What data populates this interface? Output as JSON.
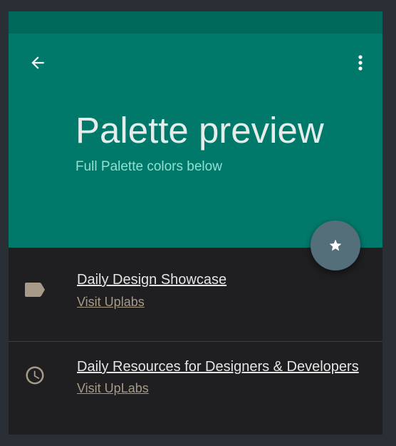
{
  "colors": {
    "primary": "#00796b",
    "primary_dark": "#00695c",
    "accent": "#546e7a",
    "background": "#1f1f21",
    "subtitle": "#8fe0d3",
    "link": "#a99a86"
  },
  "app_bar": {
    "back_icon": "arrow-back-icon",
    "more_icon": "more-vert-icon",
    "title": "Palette preview",
    "subtitle": "Full Palette colors below"
  },
  "fab": {
    "icon": "star-icon"
  },
  "list": {
    "items": [
      {
        "icon": "label-icon",
        "title": "Daily Design Showcase",
        "link": "Visit Uplabs"
      },
      {
        "icon": "clock-icon",
        "title": "Daily Resources for Designers & Developers",
        "link": "Visit UpLabs"
      }
    ]
  }
}
